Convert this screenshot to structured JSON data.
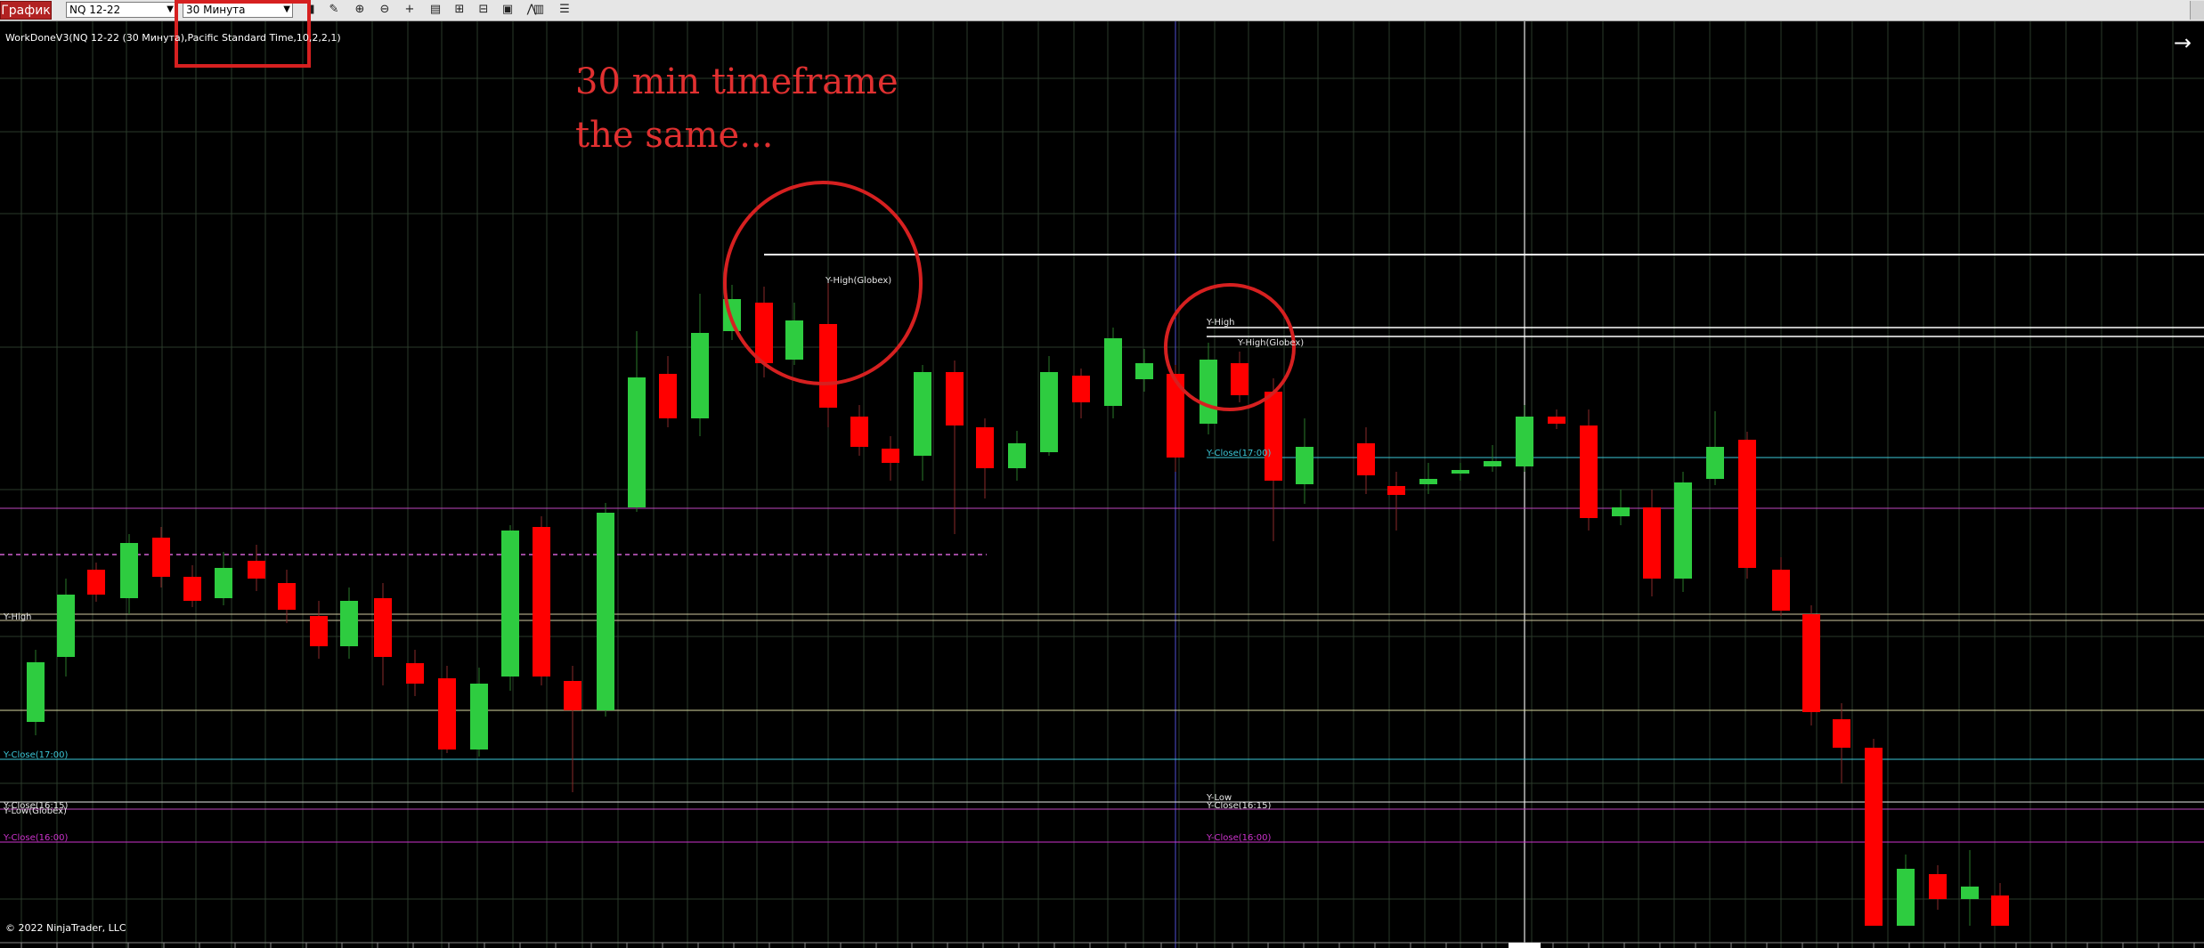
{
  "toolbar": {
    "tab_label": "График",
    "instrument": "NQ 12-22",
    "timeframe": "30 Минута",
    "icons": [
      "bar-chart-icon",
      "pencil-icon",
      "zoom-in-icon",
      "zoom-out-icon",
      "crosshair-icon",
      "data-box-icon",
      "chart-trader-icon",
      "template-icon",
      "strategy-icon",
      "indicators-icon",
      "properties-icon",
      "list-icon"
    ]
  },
  "chart": {
    "indicator_label": "WorkDoneV3(NQ 12-22 (30 Минута),Pacific Standard Time,10,2,2,1)",
    "copyright": "© 2022 NinjaTrader, LLC",
    "annotation_line1": "30 min timeframe",
    "annotation_line2": "the same...",
    "nav_arrow": "→",
    "colors": {
      "up": "#2ecc40",
      "down": "#ff0000",
      "annotation": "#e03030",
      "background": "#000000"
    },
    "levels_left": {
      "y_high": "Y-High",
      "y_close_1700": "Y-Close(17:00)",
      "y_close_1615": "Y-Close(16:15)",
      "y_low_globex": "Y-Low(Globex)",
      "y_close_1600": "Y-Close(16:00)"
    },
    "levels_mid": {
      "y_high_globex": "Y-High(Globex)",
      "y_high": "Y-High",
      "y_high_globex_2": "Y-High(Globex)",
      "y_close_1700": "Y-Close(17:00)",
      "y_low": "Y-Low",
      "y_close_1615": "Y-Close(16:15)",
      "y_close_1600": "Y-Close(16:00)"
    }
  }
}
